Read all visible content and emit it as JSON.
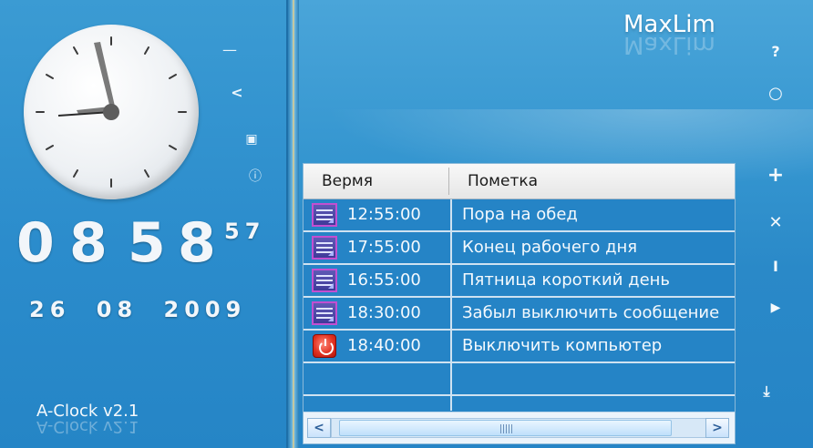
{
  "window": {
    "app_version": "A-Clock v2.1",
    "brand": "MaxLim"
  },
  "clock": {
    "hour_hand_icon": "analog-clock",
    "digital": {
      "digits": [
        "0",
        "8",
        "5",
        "8"
      ],
      "seconds": "57",
      "date": "26 08 2009"
    }
  },
  "left_controls": [
    {
      "label": "—",
      "icon": "minimize-icon"
    },
    {
      "label": "<",
      "icon": "collapse-icon"
    },
    {
      "label": "▣",
      "icon": "calendar-icon"
    },
    {
      "label": "ⓘ",
      "icon": "info-icon"
    }
  ],
  "right_controls": {
    "help": {
      "label": "?",
      "icon": "help-icon"
    },
    "settings": {
      "label": "○",
      "icon": "circle-settings-icon"
    },
    "add": {
      "label": "+",
      "icon": "add-icon"
    },
    "delete": {
      "label": "✕",
      "icon": "delete-icon"
    },
    "edit": {
      "label": "I",
      "icon": "edit-icon"
    },
    "play": {
      "label": "▶",
      "icon": "play-icon"
    },
    "down": {
      "label": "⤓",
      "icon": "scroll-down-icon"
    }
  },
  "table": {
    "headers": {
      "time": "Вермя",
      "note": "Пометка"
    },
    "rows": [
      {
        "time": "12:55:00",
        "note": "Пора на обед",
        "type": "message"
      },
      {
        "time": "17:55:00",
        "note": "Конец рабочего дня",
        "type": "message"
      },
      {
        "time": "16:55:00",
        "note": "Пятница короткий день",
        "type": "message"
      },
      {
        "time": "18:30:00",
        "note": "Забыл выключить сообщение",
        "type": "message"
      },
      {
        "time": "18:40:00",
        "note": "Выключить компьютер",
        "type": "shutdown"
      }
    ],
    "empty_rows_count": 2
  },
  "scrollbar": {
    "left_label": "<",
    "right_label": ">",
    "thumb_fraction": 0.92
  },
  "colors": {
    "accent": "#2a89c8",
    "shutdown": "#e23322",
    "message_icon": "#5f5ab6"
  }
}
